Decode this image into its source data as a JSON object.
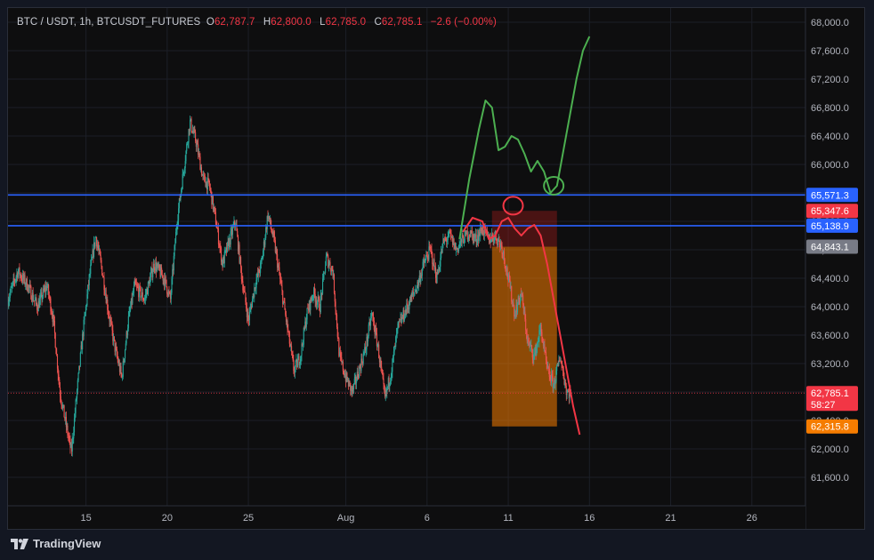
{
  "header": {
    "symbol": "BTC / USDT, 1h, BTCUSDT_FUTURES",
    "open_label": "O",
    "open": "62,787.7",
    "high_label": "H",
    "high": "62,800.0",
    "low_label": "L",
    "low": "62,785.0",
    "close_label": "C",
    "close": "62,785.1",
    "change": "−2.6 (−0.00%)"
  },
  "footer": {
    "brand": "TradingView"
  },
  "colors": {
    "up": "#26a69a",
    "down": "#ef5350",
    "level_line": "#2962ff",
    "projection_up": "#4caf50",
    "projection_down": "#f23645",
    "zone_orange": "#f57c00",
    "zone_red": "#b71c1c"
  },
  "chart_data": {
    "type": "candlestick",
    "timeframe": "1h",
    "x_ticks": [
      {
        "label": "15",
        "x": 15
      },
      {
        "label": "20",
        "x": 20
      },
      {
        "label": "25",
        "x": 25
      },
      {
        "label": "Aug",
        "x": 31
      },
      {
        "label": "6",
        "x": 36
      },
      {
        "label": "11",
        "x": 41
      },
      {
        "label": "16",
        "x": 46
      },
      {
        "label": "21",
        "x": 51
      },
      {
        "label": "26",
        "x": 56
      }
    ],
    "y_ticks": [
      "61,600.0",
      "62,000.0",
      "62,400.0",
      "62,800.0",
      "63,200.0",
      "63,600.0",
      "64,000.0",
      "64,400.0",
      "64,800.0",
      "65,200.0",
      "65,600.0",
      "66,000.0",
      "66,400.0",
      "66,800.0",
      "67,200.0",
      "67,600.0",
      "68,000.0"
    ],
    "ylim": [
      61200,
      68200
    ],
    "xlim": [
      10.2,
      59.3
    ],
    "price_path": [
      [
        10.2,
        64100
      ],
      [
        10.8,
        64500
      ],
      [
        11.4,
        64300
      ],
      [
        12.0,
        64000
      ],
      [
        12.6,
        64300
      ],
      [
        13.0,
        63800
      ],
      [
        13.4,
        62800
      ],
      [
        13.8,
        62300
      ],
      [
        14.1,
        61950
      ],
      [
        14.4,
        62700
      ],
      [
        14.8,
        63600
      ],
      [
        15.2,
        64400
      ],
      [
        15.6,
        65000
      ],
      [
        16.0,
        64500
      ],
      [
        16.4,
        63900
      ],
      [
        16.8,
        63400
      ],
      [
        17.2,
        63000
      ],
      [
        17.6,
        63800
      ],
      [
        18.0,
        64300
      ],
      [
        18.6,
        64100
      ],
      [
        19.2,
        64600
      ],
      [
        19.8,
        64400
      ],
      [
        20.2,
        64100
      ],
      [
        20.6,
        65200
      ],
      [
        21.0,
        65900
      ],
      [
        21.4,
        66600
      ],
      [
        21.8,
        66300
      ],
      [
        22.2,
        65800
      ],
      [
        22.6,
        65700
      ],
      [
        23.0,
        65200
      ],
      [
        23.4,
        64600
      ],
      [
        23.8,
        64900
      ],
      [
        24.2,
        65200
      ],
      [
        24.6,
        64400
      ],
      [
        25.0,
        63800
      ],
      [
        25.4,
        64300
      ],
      [
        25.8,
        64600
      ],
      [
        26.2,
        65300
      ],
      [
        26.6,
        64900
      ],
      [
        27.0,
        64300
      ],
      [
        27.4,
        63700
      ],
      [
        27.8,
        63100
      ],
      [
        28.2,
        63300
      ],
      [
        28.6,
        63900
      ],
      [
        29.0,
        64200
      ],
      [
        29.4,
        64000
      ],
      [
        29.8,
        64700
      ],
      [
        30.2,
        64500
      ],
      [
        30.6,
        63300
      ],
      [
        31.0,
        63000
      ],
      [
        31.4,
        62800
      ],
      [
        31.8,
        63100
      ],
      [
        32.2,
        63400
      ],
      [
        32.6,
        63900
      ],
      [
        33.0,
        63400
      ],
      [
        33.4,
        62700
      ],
      [
        33.8,
        63100
      ],
      [
        34.2,
        63700
      ],
      [
        34.6,
        63900
      ],
      [
        35.0,
        64100
      ],
      [
        35.4,
        64300
      ],
      [
        35.8,
        64600
      ],
      [
        36.2,
        64800
      ],
      [
        36.6,
        64400
      ],
      [
        37.0,
        64900
      ],
      [
        37.4,
        65000
      ],
      [
        37.8,
        64800
      ],
      [
        38.2,
        64950
      ],
      [
        38.6,
        65050
      ],
      [
        39.0,
        64950
      ],
      [
        39.4,
        65100
      ],
      [
        39.8,
        64950
      ],
      [
        40.2,
        65000
      ],
      [
        40.6,
        64850
      ],
      [
        41.0,
        64400
      ],
      [
        41.4,
        63900
      ],
      [
        41.8,
        64200
      ],
      [
        42.2,
        63500
      ],
      [
        42.6,
        63300
      ],
      [
        43.0,
        63700
      ],
      [
        43.4,
        63100
      ],
      [
        43.8,
        62900
      ],
      [
        44.2,
        63300
      ],
      [
        44.6,
        62800
      ],
      [
        44.9,
        62785
      ]
    ],
    "horizontal_levels": [
      {
        "price": 65571.3,
        "label": "65,571.3",
        "color": "#2962ff"
      },
      {
        "price": 65138.9,
        "label": "65,138.9",
        "color": "#2962ff"
      }
    ],
    "price_labels": [
      {
        "price": 65347.6,
        "label": "65,347.6",
        "color": "#f23645"
      },
      {
        "price": 64843.1,
        "label": "64,843.1",
        "color": "#787b86"
      },
      {
        "price": 62785.1,
        "label": "62,785.1",
        "sub": "58:27",
        "color": "#f23645"
      },
      {
        "price": 62315.8,
        "label": "62,315.8",
        "color": "#f57c00"
      }
    ],
    "last_price": 62785.1,
    "zones": [
      {
        "name": "short-zone-red",
        "x0": 40.0,
        "x1": 44.0,
        "p0": 65347.6,
        "p1": 64843.1,
        "color": "#b71c1c",
        "opacity": 0.35
      },
      {
        "name": "short-zone-orange",
        "x0": 40.0,
        "x1": 44.0,
        "p0": 64843.1,
        "p1": 62315.8,
        "color": "#f57c00",
        "opacity": 0.55
      }
    ],
    "projection_bull": [
      [
        38.0,
        64950
      ],
      [
        38.6,
        65800
      ],
      [
        39.2,
        66500
      ],
      [
        39.6,
        66900
      ],
      [
        40.0,
        66800
      ],
      [
        40.4,
        66200
      ],
      [
        40.8,
        66250
      ],
      [
        41.2,
        66400
      ],
      [
        41.6,
        66350
      ],
      [
        42.0,
        66150
      ],
      [
        42.4,
        65900
      ],
      [
        42.8,
        66050
      ],
      [
        43.2,
        65900
      ],
      [
        43.6,
        65600
      ],
      [
        44.0,
        65700
      ],
      [
        44.4,
        66200
      ],
      [
        44.8,
        66700
      ],
      [
        45.2,
        67200
      ],
      [
        45.6,
        67600
      ],
      [
        46.0,
        67800
      ]
    ],
    "projection_bear": [
      [
        38.2,
        65050
      ],
      [
        38.8,
        65250
      ],
      [
        39.4,
        65200
      ],
      [
        39.8,
        64950
      ],
      [
        40.2,
        65000
      ],
      [
        40.6,
        65200
      ],
      [
        41.0,
        65250
      ],
      [
        41.4,
        65100
      ],
      [
        41.8,
        65000
      ],
      [
        42.2,
        65100
      ],
      [
        42.6,
        65150
      ],
      [
        43.0,
        65000
      ],
      [
        43.4,
        64600
      ],
      [
        43.8,
        64100
      ],
      [
        44.2,
        63600
      ],
      [
        44.6,
        63100
      ],
      [
        45.0,
        62600
      ],
      [
        45.4,
        62200
      ]
    ],
    "circles": [
      {
        "x": 41.3,
        "price": 65420,
        "color": "#f23645"
      },
      {
        "x": 43.8,
        "price": 65700,
        "color": "#4caf50"
      }
    ]
  }
}
